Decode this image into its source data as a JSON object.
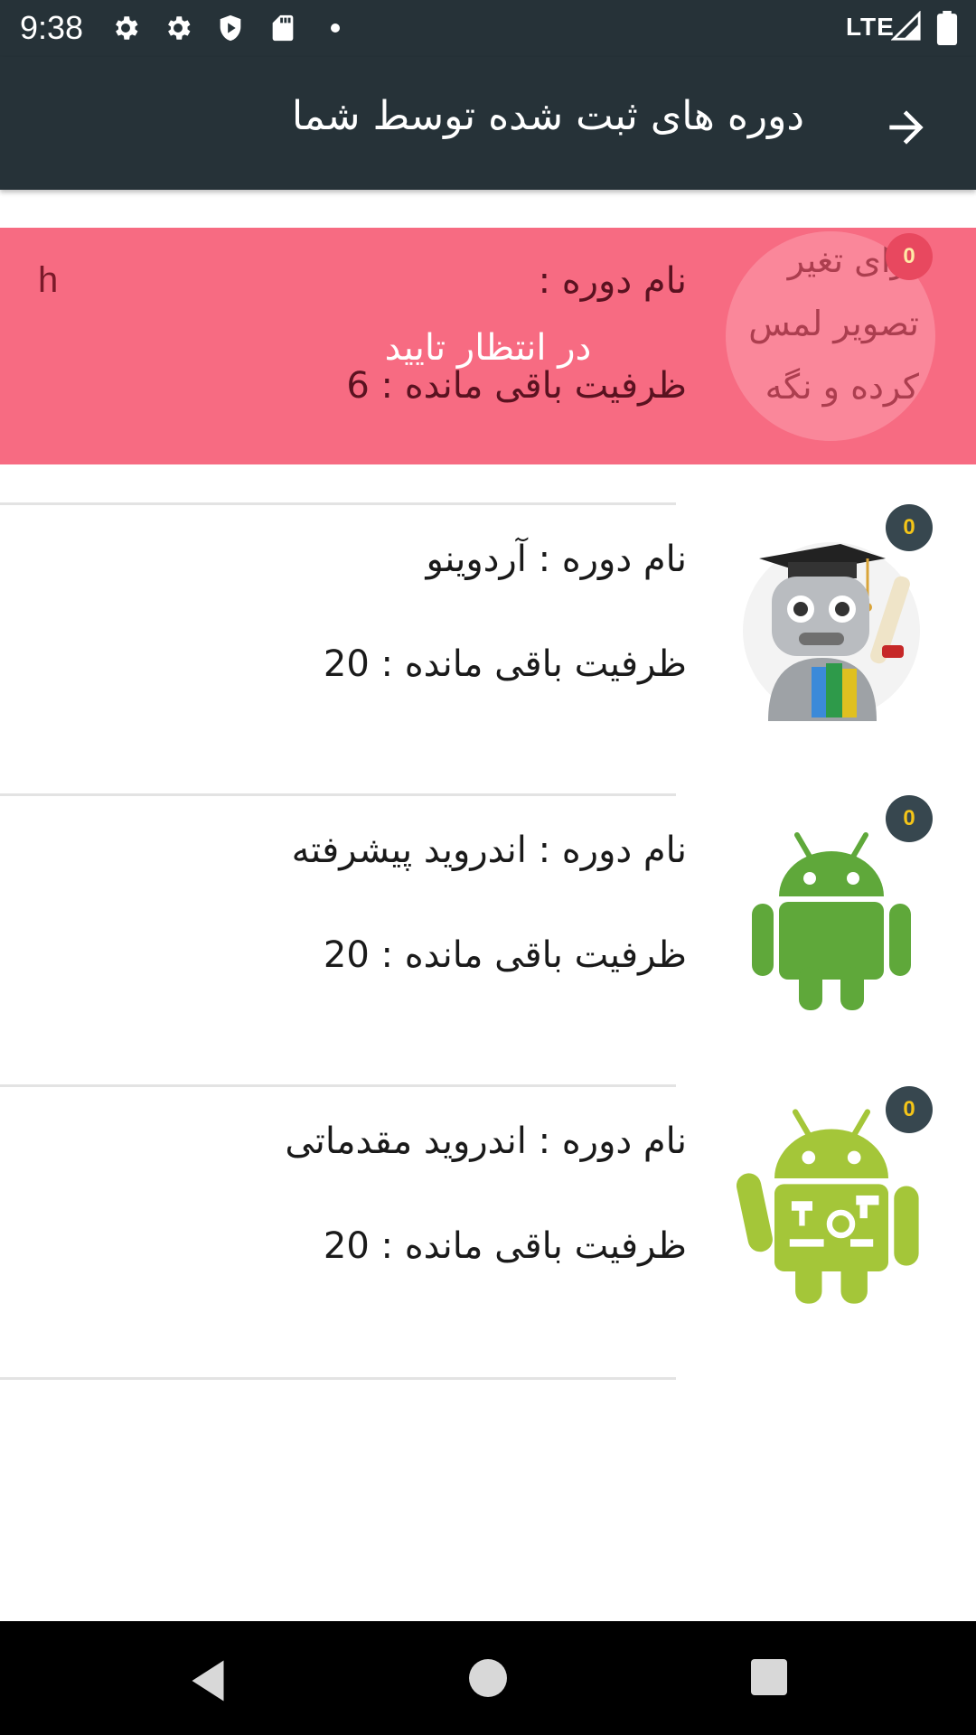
{
  "status_bar": {
    "time": "9:38",
    "network": "LTE",
    "icons": [
      "gear-icon",
      "gear-icon",
      "shield-play-icon",
      "sd-card-icon",
      "dot-icon",
      "signal-icon",
      "battery-icon"
    ]
  },
  "app_bar": {
    "title": "دوره های ثبت شده توسط شما",
    "back_icon": "arrow-right-icon"
  },
  "colors": {
    "app_bar": "#263238",
    "pending_row": "#f76b82",
    "badge_bg": "#37474f",
    "badge_text": "#f5c518"
  },
  "courses": [
    {
      "name": "نام دوره : ",
      "capacity": "ظرفیت باقی مانده : 6",
      "status": "در انتظار تایید",
      "side_text": "h",
      "badge": "0",
      "image_hint": [
        "برای تغیر",
        "تصویر لمس",
        "کرده و نگه"
      ]
    },
    {
      "name": "نام دوره : آردوینو",
      "capacity": "ظرفیت باقی مانده : 20",
      "badge": "0",
      "image": "robot-graduate-icon"
    },
    {
      "name": "نام دوره : اندروید پیشرفته",
      "capacity": "ظرفیت باقی مانده : 20",
      "badge": "0",
      "image": "android-icon"
    },
    {
      "name": "نام دوره : اندروید مقدماتی",
      "capacity": "ظرفیت باقی مانده : 20",
      "badge": "0",
      "image": "android-tools-icon"
    }
  ],
  "nav_bar": {
    "icons": [
      "back-triangle-icon",
      "home-circle-icon",
      "recents-square-icon"
    ]
  }
}
